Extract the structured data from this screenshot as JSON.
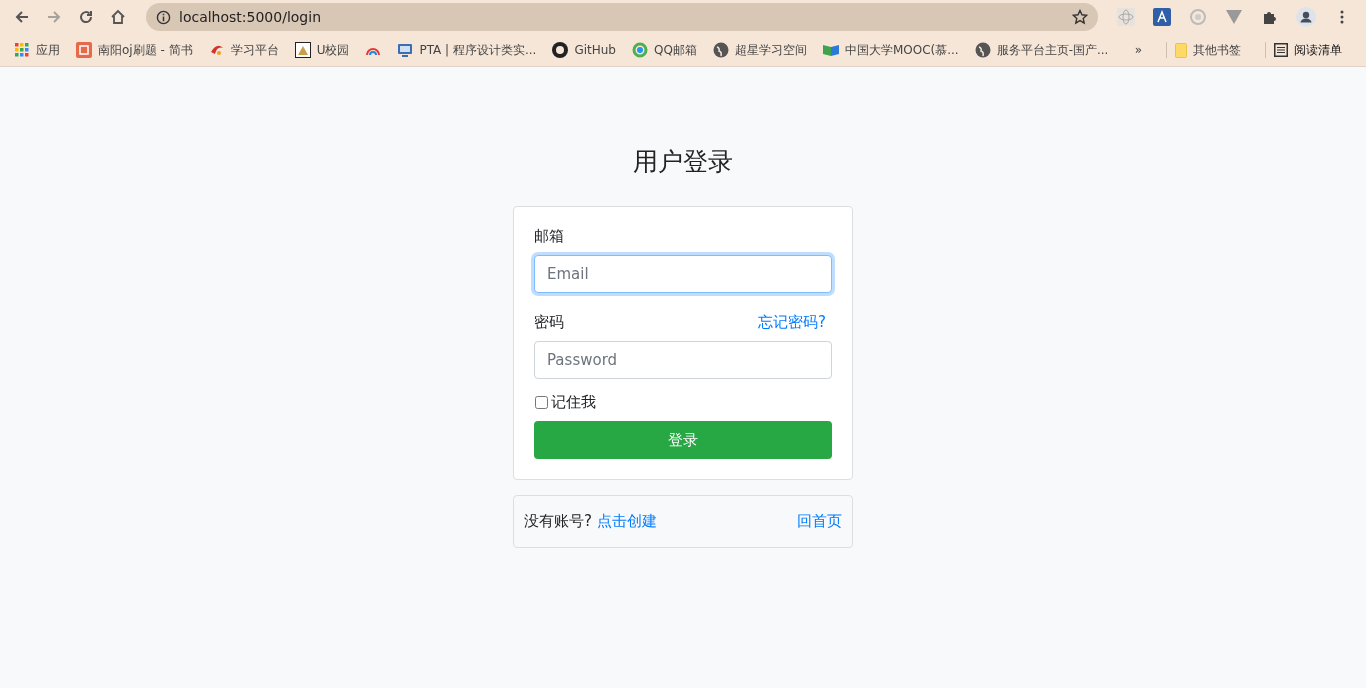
{
  "browser": {
    "url": "localhost:5000/login",
    "bookmarks": [
      {
        "label": "应用",
        "kind": "grid"
      },
      {
        "label": "南阳oj刷题 - 简书",
        "kind": "jian"
      },
      {
        "label": "学习平台",
        "kind": "swirl"
      },
      {
        "label": "U校园",
        "kind": "cat"
      },
      {
        "kind": "rainbow"
      },
      {
        "label": "PTA | 程序设计类实...",
        "kind": "monitor"
      },
      {
        "label": "GitHub",
        "kind": "github"
      },
      {
        "label": "QQ邮箱",
        "kind": "ring"
      },
      {
        "label": "超星学习空间",
        "kind": "globe"
      },
      {
        "label": "中国大学MOOC(慕...",
        "kind": "book"
      },
      {
        "label": "服务平台主页-国产...",
        "kind": "globe"
      }
    ],
    "overflow": "»",
    "other_bookmarks": "其他书签",
    "reading_list": "阅读清单"
  },
  "login": {
    "title": "用户登录",
    "email_label": "邮箱",
    "email_placeholder": "Email",
    "email_focused": true,
    "password_label": "密码",
    "forgot_link": "忘记密码?",
    "password_placeholder": "Password",
    "remember_label": "记住我",
    "remember_checked": false,
    "submit": "登录"
  },
  "footer": {
    "prompt": "没有账号?",
    "create_link": "点击创建",
    "home_link": "回首页"
  }
}
